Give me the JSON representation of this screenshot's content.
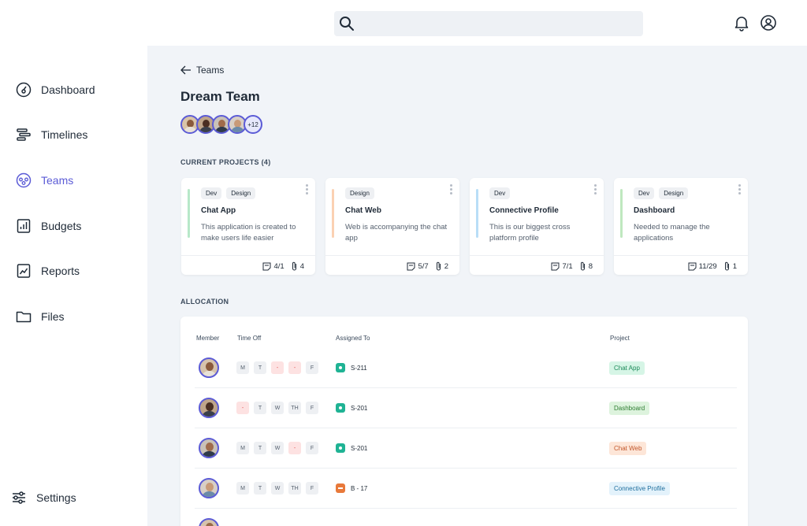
{
  "search": {
    "value": "",
    "placeholder": ""
  },
  "sidebar": {
    "items": [
      {
        "label": "Dashboard",
        "icon": "dashboard-icon"
      },
      {
        "label": "Timelines",
        "icon": "timelines-icon"
      },
      {
        "label": "Teams",
        "icon": "teams-icon",
        "active": true
      },
      {
        "label": "Budgets",
        "icon": "budgets-icon"
      },
      {
        "label": "Reports",
        "icon": "reports-icon"
      },
      {
        "label": "Files",
        "icon": "folder-icon"
      }
    ],
    "settings_label": "Settings"
  },
  "breadcrumb": {
    "back_label": "Teams"
  },
  "team": {
    "title": "Dream Team",
    "more_members": "+12"
  },
  "projects": {
    "section_label": "CURRENT PROJECTS (4)",
    "cards": [
      {
        "tags": [
          "Dev",
          "Design"
        ],
        "title": "Chat App",
        "description": "This application is created to make users life easier",
        "tasks": "4/1",
        "attachments": "4",
        "accent": "#b7e8c9"
      },
      {
        "tags": [
          "Design"
        ],
        "title": "Chat Web",
        "description": "Web is accompanying the chat app",
        "tasks": "5/7",
        "attachments": "2",
        "accent": "#fbd1b3"
      },
      {
        "tags": [
          "Dev"
        ],
        "title": "Connective Profile",
        "description": "This is our biggest cross platform profile",
        "tasks": "7/1",
        "attachments": "8",
        "accent": "#b9def7"
      },
      {
        "tags": [
          "Dev",
          "Design"
        ],
        "title": "Dashboard",
        "description": "Needed to manage the applications",
        "tasks": "11/29",
        "attachments": "1",
        "accent": "#bfe8bf"
      }
    ]
  },
  "allocation": {
    "section_label": "ALLOCATION",
    "headers": {
      "member": "Member",
      "time_off": "Time Off",
      "assigned_to": "Assigned To",
      "project": "Project"
    },
    "rows": [
      {
        "days": [
          [
            "M",
            false
          ],
          [
            "T",
            false
          ],
          [
            "-",
            true
          ],
          [
            "-",
            true
          ],
          [
            "F",
            false
          ]
        ],
        "task": "S-211",
        "task_type": "story",
        "project": "Chat App",
        "project_bg": "#d6f5e6",
        "project_fg": "#1e8a5a"
      },
      {
        "days": [
          [
            "-",
            true
          ],
          [
            "T",
            false
          ],
          [
            "W",
            false
          ],
          [
            "TH",
            false
          ],
          [
            "F",
            false
          ]
        ],
        "task": "S-201",
        "task_type": "story",
        "project": "Dashboard",
        "project_bg": "#ddf3dd",
        "project_fg": "#2e7d32"
      },
      {
        "days": [
          [
            "M",
            false
          ],
          [
            "T",
            false
          ],
          [
            "W",
            false
          ],
          [
            "-",
            true
          ],
          [
            "F",
            false
          ]
        ],
        "task": "S-201",
        "task_type": "story",
        "project": "Chat Web",
        "project_bg": "#fde6d8",
        "project_fg": "#c2562a"
      },
      {
        "days": [
          [
            "M",
            false
          ],
          [
            "T",
            false
          ],
          [
            "W",
            false
          ],
          [
            "TH",
            false
          ],
          [
            "F",
            false
          ]
        ],
        "task": "B - 17",
        "task_type": "bug",
        "project": "Connective Profile",
        "project_bg": "#e3f2fb",
        "project_fg": "#1f6f9e"
      }
    ]
  },
  "colors": {
    "accent": "#5b5bd6",
    "story": "#1fb394",
    "bug": "#e8793a",
    "main_bg": "#f1f4f8"
  }
}
